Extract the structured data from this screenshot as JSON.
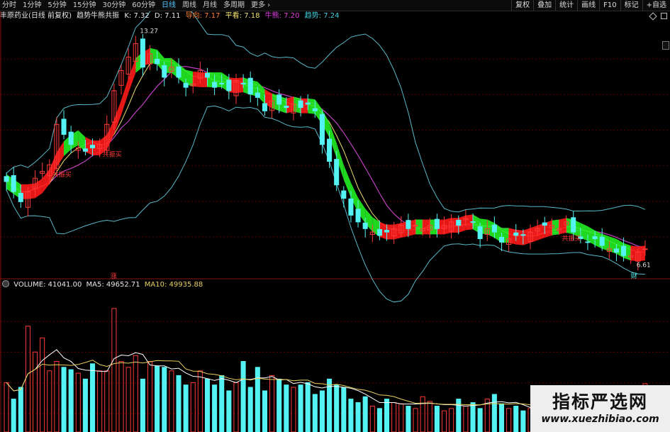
{
  "toolbar": {
    "period_tabs": [
      "分时",
      "1分钟",
      "5分钟",
      "15分钟",
      "30分钟",
      "60分钟",
      "日线",
      "周线",
      "月线",
      "多周期",
      "更多"
    ],
    "active_tab": "日线",
    "more_caret": "›",
    "right_buttons": [
      "复权",
      "叠加",
      "统计",
      "画线",
      "F10",
      "标记",
      "+自选"
    ]
  },
  "info": {
    "stock": "丰原药业(日线 前复权)",
    "indicator": "趋势牛熊共振",
    "k": "K: 7.32",
    "d": "D: 7.11",
    "guide": "导向: 7.17",
    "flat": "平看: 7.18",
    "bull": "牛熊: 7.20",
    "trend": "趋势: 7.24"
  },
  "volume_info": {
    "label": "VOLUME: 41041.00",
    "ma5": "MA5: 49652.71",
    "ma10": "MA10: 49935.88"
  },
  "annotations": {
    "high_label": "13.27",
    "low_label": "6.61",
    "buy_label": "共振买",
    "zhang": "涨",
    "cai": "财"
  },
  "watermark": {
    "cn": "指标严选网",
    "url": "www.xuezhibiao.com"
  },
  "colors": {
    "up": "#ff3b3b",
    "down": "#54f2f2",
    "bull_band": "#ff1a1a",
    "bear_band": "#22ee22",
    "bollinger": "#5ab8c8",
    "trend_line": "#c040c0",
    "guide_line": "#f0e070",
    "ma5": "#ffffff",
    "ma10": "#e8d060",
    "grid": "#5a0000"
  },
  "chart_data": [
    {
      "type": "candlestick",
      "title": "丰原药业(日线 前复权)",
      "ylim": [
        6.2,
        13.6
      ],
      "grid": true,
      "high": 13.27,
      "low": 6.61,
      "close_series": [
        8.9,
        8.6,
        8.3,
        8.6,
        9.0,
        9.2,
        9.4,
        10.6,
        10.3,
        10.0,
        9.9,
        9.8,
        9.9,
        10.0,
        10.6,
        11.6,
        12.2,
        12.6,
        13.0,
        12.3,
        12.7,
        12.4,
        12.0,
        12.3,
        12.0,
        11.7,
        11.8,
        12.2,
        12.0,
        11.7,
        11.8,
        11.6,
        11.9,
        11.8,
        11.5,
        11.4,
        11.0,
        11.3,
        11.2,
        11.1,
        11.2,
        11.1,
        11.2,
        11.0,
        10.0,
        9.5,
        8.8,
        8.4,
        7.9,
        7.7,
        7.5,
        7.4,
        7.3,
        7.4,
        7.5,
        7.6,
        7.5,
        7.6,
        7.5,
        7.6,
        7.5,
        7.6,
        7.7,
        7.6,
        7.8,
        7.7,
        7.2,
        7.5,
        7.4,
        7.1,
        7.2,
        7.3,
        7.3,
        7.4,
        7.5,
        7.6,
        7.6,
        7.5,
        7.7,
        7.4,
        7.2,
        7.1,
        7.2,
        7.0,
        6.9,
        6.8,
        6.7,
        6.7,
        6.8,
        6.9
      ]
    },
    {
      "type": "bar",
      "title": "VOLUME",
      "ylim": [
        0,
        120000
      ],
      "values": [
        42000,
        28000,
        38000,
        90000,
        68000,
        80000,
        52000,
        60000,
        55000,
        53000,
        50000,
        45000,
        58000,
        52000,
        52000,
        105000,
        60000,
        55000,
        65000,
        45000,
        60000,
        56000,
        55000,
        52000,
        48000,
        40000,
        42000,
        52000,
        45000,
        40000,
        48000,
        35000,
        42000,
        60000,
        38000,
        55000,
        35000,
        48000,
        45000,
        40000,
        38000,
        40000,
        42000,
        32000,
        35000,
        45000,
        40000,
        38000,
        28000,
        25000,
        30000,
        22000,
        20000,
        28000,
        25000,
        24000,
        22000,
        20000,
        30000,
        26000,
        22000,
        18000,
        20000,
        28000,
        22000,
        25000,
        20000,
        28000,
        32000,
        24000,
        20000,
        22000,
        18000,
        20000,
        24000,
        30000,
        24000,
        20000,
        26000,
        22000,
        20000,
        35000,
        28000,
        30000,
        22000,
        20000,
        18000,
        22000,
        26000,
        41041
      ],
      "ma5": [
        49652.71
      ],
      "ma10": [
        49935.88
      ]
    }
  ]
}
